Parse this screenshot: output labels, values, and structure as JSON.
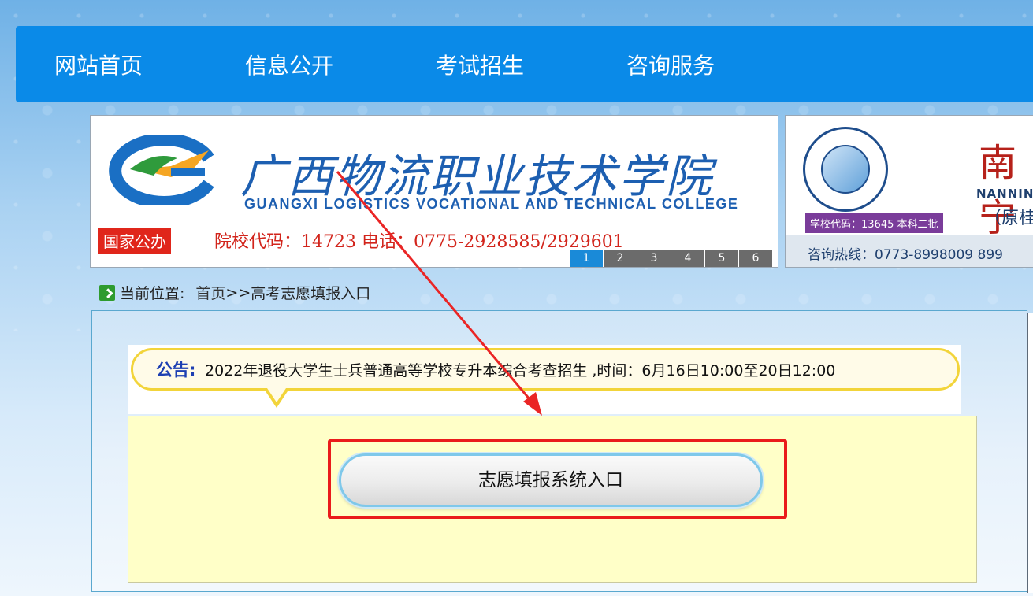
{
  "nav": {
    "items": [
      "网站首页",
      "信息公开",
      "考试招生",
      "咨询服务"
    ]
  },
  "banner": {
    "cn_title": "广西物流职业技术学院",
    "en_title": "GUANGXI LOGISTICS VOCATIONAL AND TECHNICAL COLLEGE",
    "tag": "国家公办",
    "code_line": "院校代码：14723    电话：0775-2928585/2929601",
    "pages": [
      "1",
      "2",
      "3",
      "4",
      "5",
      "6"
    ],
    "active_page": "1"
  },
  "banner2": {
    "brand": "南宁",
    "en": "NANNIN",
    "formerly": "（原桂",
    "code": "学校代码：13645  本科二批",
    "hotline": "咨询热线：0773-8998009   899"
  },
  "breadcrumb": {
    "prefix": "当前位置:",
    "home": "首页",
    "sep": ">>",
    "current": "高考志愿填报入口"
  },
  "notice": {
    "label": "公告:",
    "text": "2022年退役大学生士兵普通高等学校专升本综合考查招生 ,时间：6月16日10:00至20日12:00"
  },
  "entry_button": {
    "label": "志愿填报系统入口"
  },
  "colors": {
    "nav_bg": "#0a8ae8",
    "highlight": "#ea1b1b",
    "notice_border": "#f2d43a",
    "panel_bg": "#ffffc8"
  }
}
